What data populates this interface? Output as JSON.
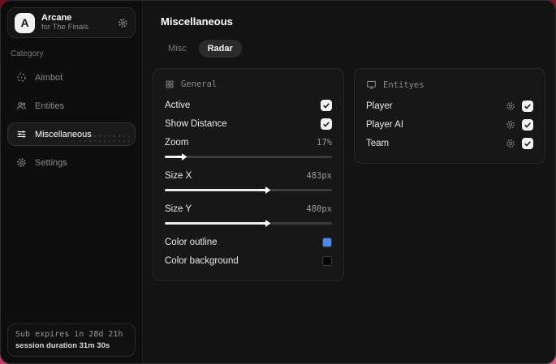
{
  "app": {
    "name": "Arcane",
    "subtitle": "for The Finals",
    "logo_letter": "A"
  },
  "sidebar": {
    "category_label": "Category",
    "items": [
      {
        "label": "Aimbot",
        "icon": "crosshair-icon",
        "active": false
      },
      {
        "label": "Entities",
        "icon": "users-icon",
        "active": false
      },
      {
        "label": "Miscellaneous",
        "icon": "sliders-icon",
        "active": true
      },
      {
        "label": "Settings",
        "icon": "gear-icon",
        "active": false
      }
    ],
    "footer": {
      "sub_expires": "Sub expires in 28d 21h",
      "session_duration": "session duration 31m 30s"
    }
  },
  "main": {
    "title": "Miscellaneous",
    "tabs": [
      {
        "label": "Misc",
        "active": false
      },
      {
        "label": "Radar",
        "active": true
      }
    ]
  },
  "general_panel": {
    "title": "General",
    "icon": "grid-icon",
    "toggles": [
      {
        "label": "Active",
        "checked": true
      },
      {
        "label": "Show Distance",
        "checked": true
      }
    ],
    "sliders": [
      {
        "label": "Zoom",
        "value": "17%",
        "percent": 8
      },
      {
        "label": "Size X",
        "value": "483px",
        "percent": 58
      },
      {
        "label": "Size Y",
        "value": "480px",
        "percent": 58
      }
    ],
    "colors": [
      {
        "label": "Color outline",
        "hex": "#4b8af0"
      },
      {
        "label": "Color background",
        "hex": "#060606"
      }
    ]
  },
  "entities_panel": {
    "title": "Entityes",
    "icon": "monitor-icon",
    "rows": [
      {
        "label": "Player",
        "checked": true
      },
      {
        "label": "Player AI",
        "checked": true
      },
      {
        "label": "Team",
        "checked": true
      }
    ]
  },
  "colors": {
    "accent_blue": "#4b8af0",
    "desktop_background_top": "#6e101f",
    "desktop_background_bottom": "#e0557f"
  }
}
